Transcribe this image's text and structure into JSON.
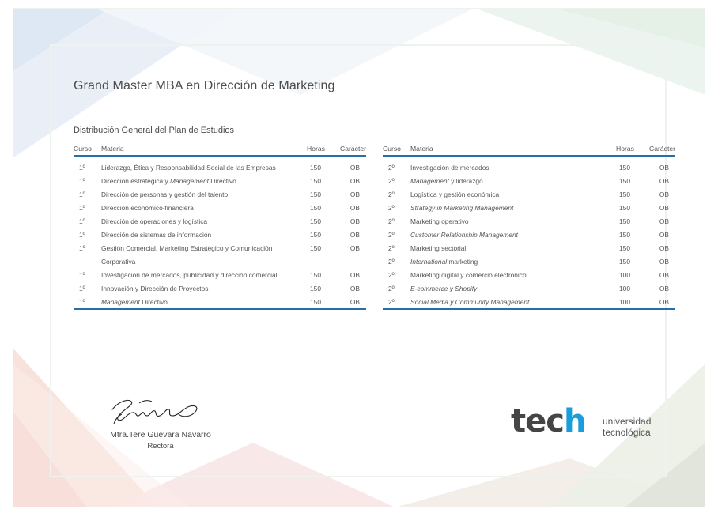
{
  "colors": {
    "accent": "#2a6ea8",
    "brand_blue": "#1a9edb",
    "text": "#4a4a4a"
  },
  "title": "Grand Master MBA en Dirección de Marketing",
  "subtitle": "Distribución General del Plan de Estudios",
  "headers": {
    "curso": "Curso",
    "materia": "Materia",
    "horas": "Horas",
    "caracter": "Carácter"
  },
  "left_rows": [
    {
      "curso": "1º",
      "materia": "Liderazgo, Ética y Responsabilidad Social de las Empresas",
      "horas": "150",
      "caracter": "OB"
    },
    {
      "curso": "1º",
      "materia": "Dirección estratégica y Management Directivo",
      "horas": "150",
      "caracter": "OB"
    },
    {
      "curso": "1º",
      "materia": "Dirección de personas y gestión del talento",
      "horas": "150",
      "caracter": "OB"
    },
    {
      "curso": "1º",
      "materia": "Dirección económico-financiera",
      "horas": "150",
      "caracter": "OB"
    },
    {
      "curso": "1º",
      "materia": "Dirección de operaciones y logística",
      "horas": "150",
      "caracter": "OB"
    },
    {
      "curso": "1º",
      "materia": "Dirección de sistemas de información",
      "horas": "150",
      "caracter": "OB"
    },
    {
      "curso": "1º",
      "materia": "Gestión Comercial, Marketing Estratégico y Comunicación",
      "horas": "150",
      "caracter": "OB"
    },
    {
      "curso": "",
      "materia": "Corporativa",
      "horas": "",
      "caracter": ""
    },
    {
      "curso": "1º",
      "materia": "Investigación de mercados, publicidad y dirección comercial",
      "horas": "150",
      "caracter": "OB"
    },
    {
      "curso": "1º",
      "materia": "Innovación y Dirección de Proyectos",
      "horas": "150",
      "caracter": "OB"
    },
    {
      "curso": "1º",
      "materia": "Management Directivo",
      "horas": "150",
      "caracter": "OB"
    }
  ],
  "right_rows": [
    {
      "curso": "2º",
      "materia": "Investigación de mercados",
      "horas": "150",
      "caracter": "OB"
    },
    {
      "curso": "2º",
      "materia": "Management y liderazgo",
      "horas": "150",
      "caracter": "OB"
    },
    {
      "curso": "2º",
      "materia": "Logística y gestión económica",
      "horas": "150",
      "caracter": "OB"
    },
    {
      "curso": "2º",
      "materia": "Strategy in Marketing Management",
      "horas": "150",
      "caracter": "OB"
    },
    {
      "curso": "2º",
      "materia": "Marketing operativo",
      "horas": "150",
      "caracter": "OB"
    },
    {
      "curso": "2º",
      "materia": "Customer Relationship Management",
      "horas": "150",
      "caracter": "OB"
    },
    {
      "curso": "2º",
      "materia": "Marketing sectorial",
      "horas": "150",
      "caracter": "OB"
    },
    {
      "curso": "2º",
      "materia": "International marketing",
      "horas": "150",
      "caracter": "OB"
    },
    {
      "curso": "2º",
      "materia": "Marketing digital y comercio electrónico",
      "horas": "100",
      "caracter": "OB"
    },
    {
      "curso": "2º",
      "materia": "E-commerce y Shopify",
      "horas": "100",
      "caracter": "OB"
    },
    {
      "curso": "2º",
      "materia": "Social Media y Community Management",
      "horas": "100",
      "caracter": "OB"
    }
  ],
  "signature": {
    "name": "Mtra.Tere Guevara Navarro",
    "role": "Rectora"
  },
  "logo": {
    "word_a": "tec",
    "word_b": "h",
    "line1": "universidad",
    "line2": "tecnológica"
  }
}
